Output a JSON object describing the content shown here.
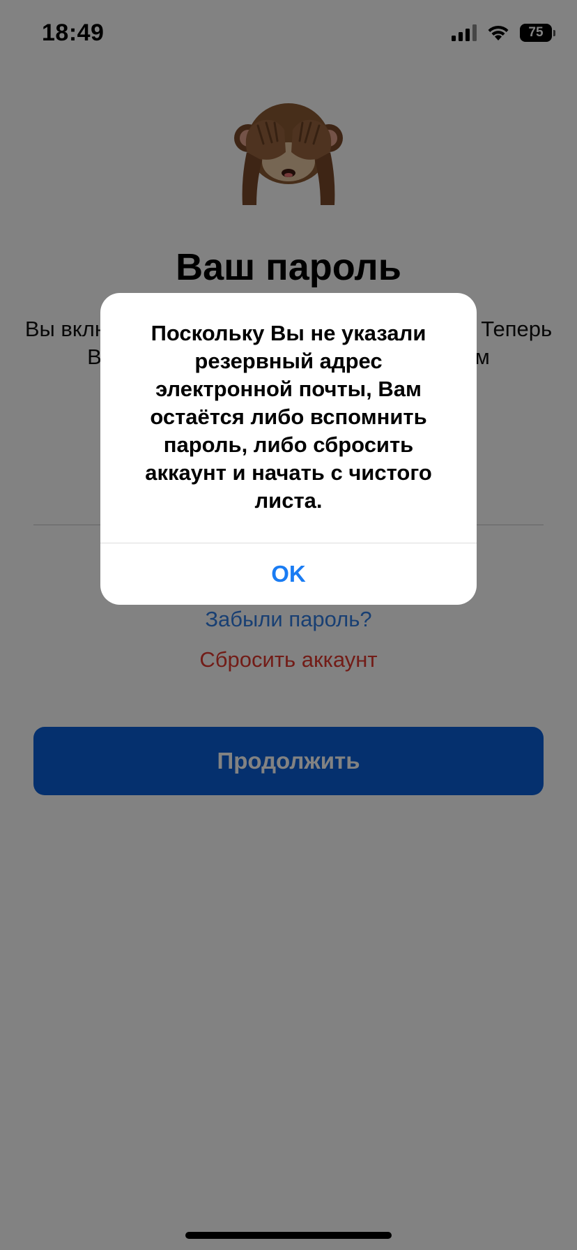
{
  "status_bar": {
    "time": "18:49",
    "battery": "75"
  },
  "screen": {
    "title": "Ваш пароль",
    "description": "Вы включили двухэтапную аутентификацию. Теперь Ваш аккаунт защищён дополнительным",
    "forgot_password_link": "Забыли пароль?",
    "reset_account_link": "Сбросить аккаунт",
    "continue_button": "Продолжить"
  },
  "alert": {
    "message": "Поскольку Вы не указали резервный адрес электронной почты, Вам остаётся либо вспомнить пароль, либо сбросить аккаунт и начать с чистого листа.",
    "ok_button": "OK"
  },
  "colors": {
    "link_blue": "#2f7de1",
    "destructive_red": "#e0382d",
    "primary_button": "#0a5fd8",
    "alert_button_blue": "#1a7cf3"
  },
  "icons": {
    "hero": "see-no-evil-monkey-icon"
  }
}
